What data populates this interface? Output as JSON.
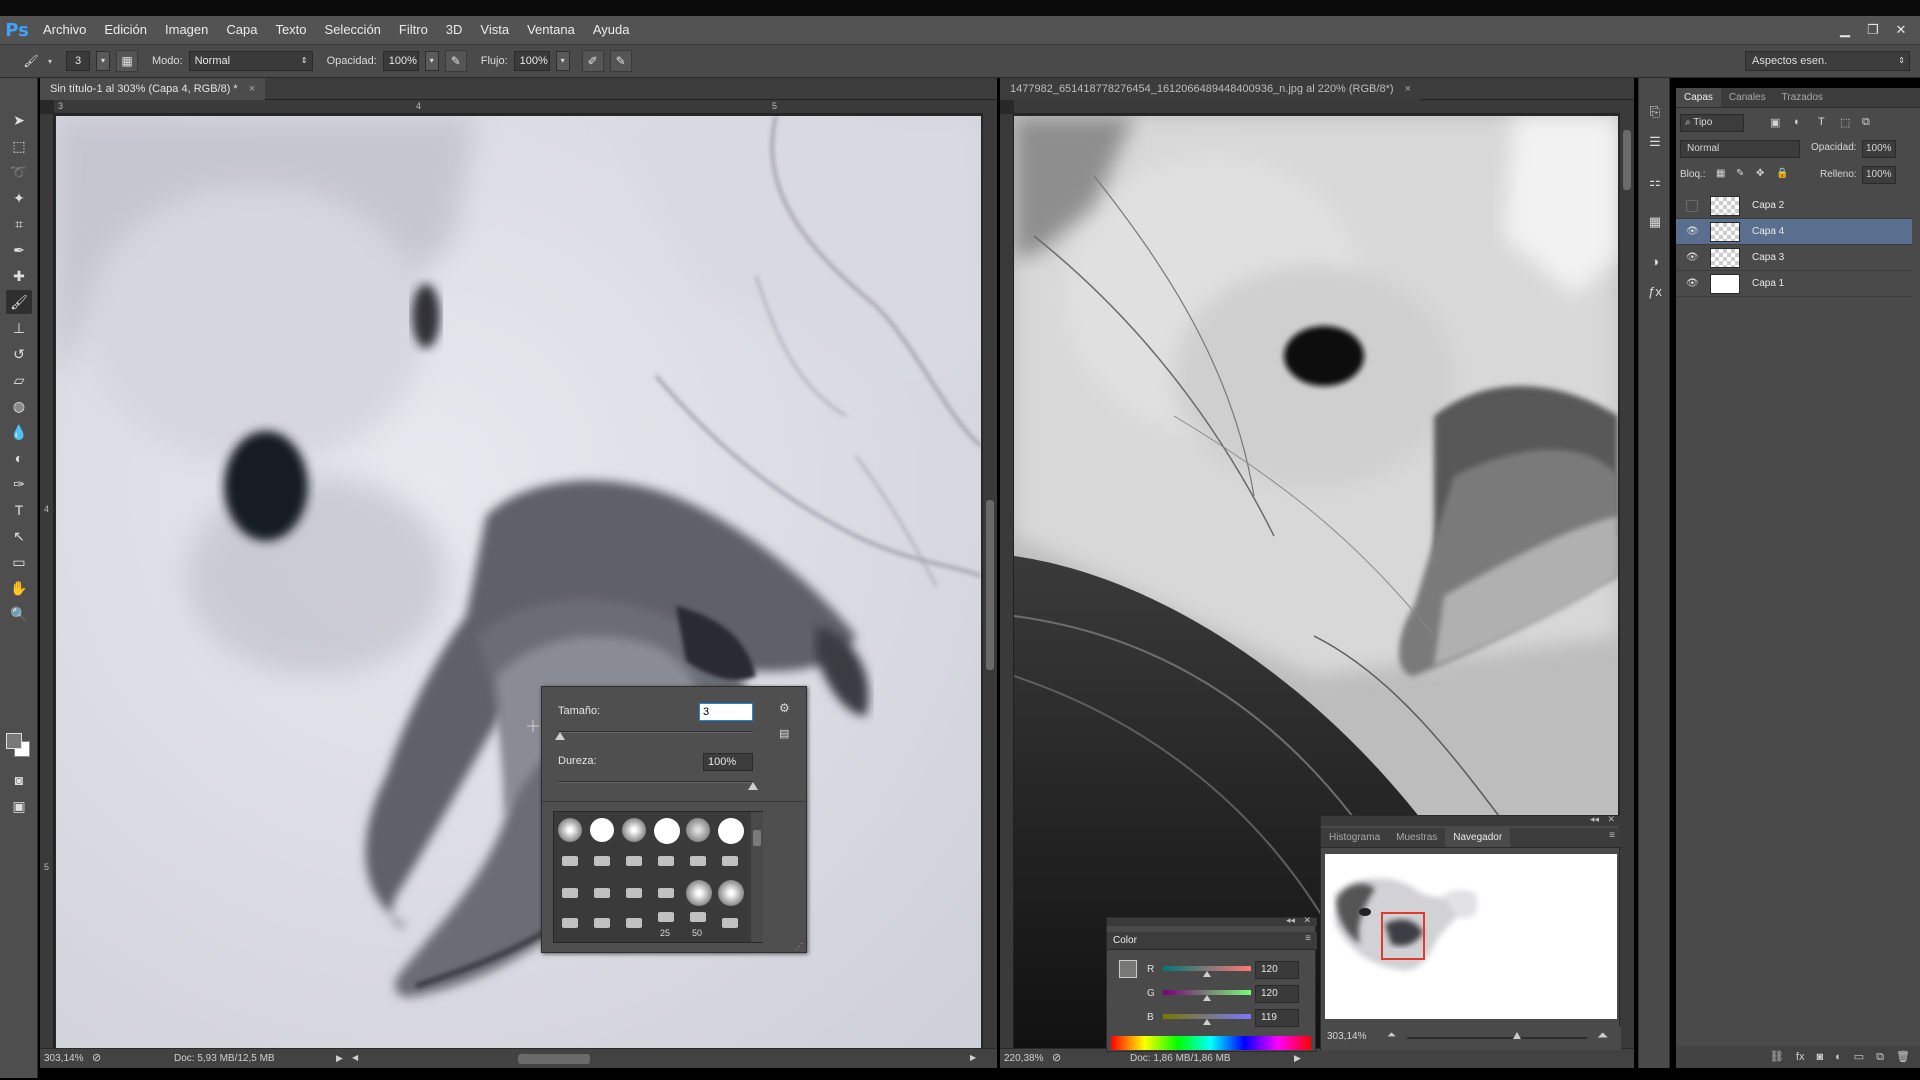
{
  "app": {
    "logo": "Ps"
  },
  "menu": [
    "Archivo",
    "Edición",
    "Imagen",
    "Capa",
    "Texto",
    "Selección",
    "Filtro",
    "3D",
    "Vista",
    "Ventana",
    "Ayuda"
  ],
  "options": {
    "brush_size": "3",
    "mode_label": "Modo:",
    "mode_value": "Normal",
    "opacity_label": "Opacidad:",
    "opacity_value": "100%",
    "flow_label": "Flujo:",
    "flow_value": "100%",
    "workspace": "Aspectos esen."
  },
  "doc1": {
    "tab": "Sin título-1 al 303% (Capa 4, RGB/8) *",
    "ruler_h": [
      "3",
      "4",
      "5"
    ],
    "ruler_v": [
      "4",
      "5"
    ],
    "zoom": "303,14%",
    "doc_info": "Doc: 5,93 MB/12,5 MB"
  },
  "doc2": {
    "tab": "1477982_651418778276454_1612066489448400936_n.jpg al 220% (RGB/8*)",
    "zoom": "220,38%",
    "doc_info": "Doc: 1,86 MB/1,86 MB"
  },
  "brush_popup": {
    "size_label": "Tamaño:",
    "size_value": "3",
    "size_fraction": 0.01,
    "hardness_label": "Dureza:",
    "hardness_value": "100%",
    "hardness_fraction": 1.0,
    "preset_num_1": "25",
    "preset_num_2": "50"
  },
  "layers_panel": {
    "tabs": [
      "Capas",
      "Canales",
      "Trazados"
    ],
    "filter": "Tipo",
    "blend_mode": "Normal",
    "opacity_label": "Opacidad:",
    "opacity_value": "100%",
    "lock_label": "Bloq.:",
    "fill_label": "Relleno:",
    "fill_value": "100%",
    "layers": [
      {
        "name": "Capa 2",
        "visible": false,
        "selected": false
      },
      {
        "name": "Capa 4",
        "visible": true,
        "selected": true
      },
      {
        "name": "Capa 3",
        "visible": true,
        "selected": false
      },
      {
        "name": "Capa 1",
        "visible": true,
        "selected": false
      }
    ]
  },
  "navigator_panel": {
    "tabs": [
      "Histograma",
      "Muestras",
      "Navegador"
    ],
    "zoom": "303,14%"
  },
  "color_panel": {
    "title": "Color",
    "r_label": "R",
    "r_value": "120",
    "g_label": "G",
    "g_value": "120",
    "b_label": "B",
    "b_value": "119"
  },
  "colors": {
    "foreground": "#787877",
    "background": "#ffffff",
    "selected_layer": "#5a6f8f",
    "navigator_box": "#e23b2d"
  },
  "icons": [
    "move-icon",
    "marquee-icon",
    "lasso-icon",
    "magic-wand-icon",
    "crop-icon",
    "eyedropper-icon",
    "healing-brush-icon",
    "brush-icon",
    "clone-stamp-icon",
    "history-brush-icon",
    "eraser-icon",
    "paint-bucket-icon",
    "blur-icon",
    "dodge-icon",
    "pen-icon",
    "type-icon",
    "path-selection-icon",
    "rectangle-icon",
    "hand-icon",
    "zoom-icon"
  ]
}
